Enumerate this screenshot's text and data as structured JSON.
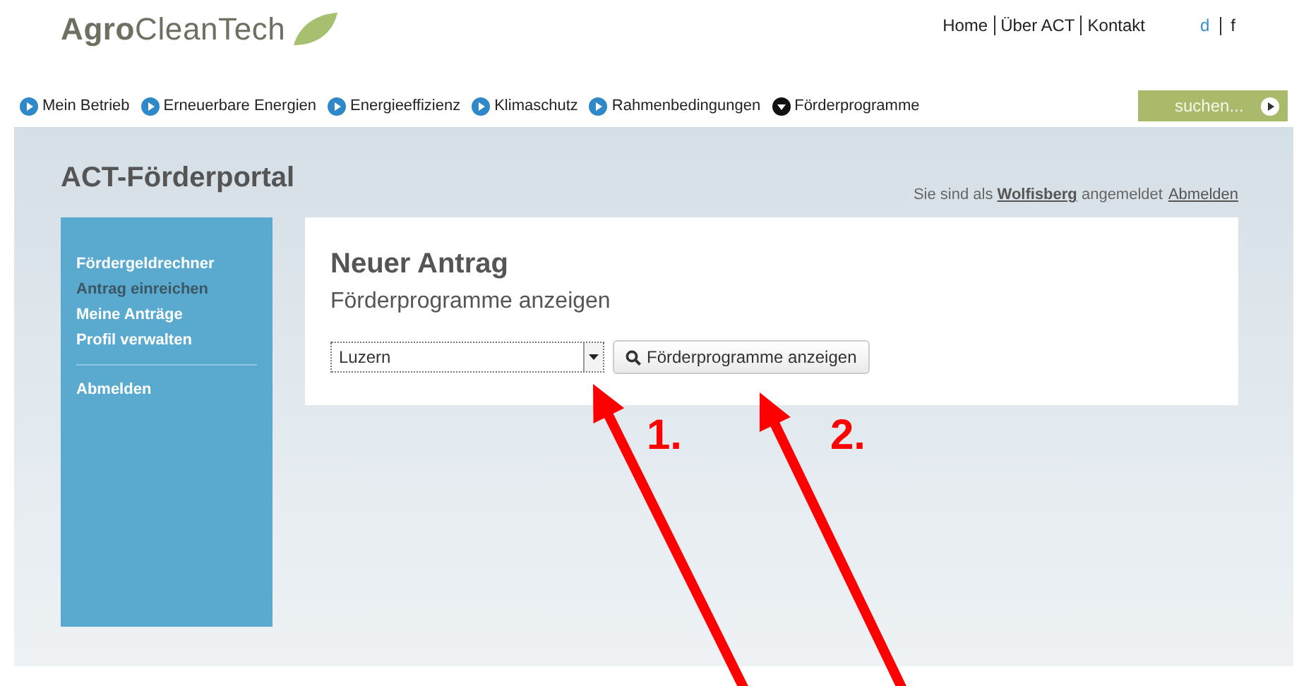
{
  "logo": {
    "text": "**Agro**CleanTech"
  },
  "top_links": [
    "Home",
    "Über ACT",
    "Kontakt"
  ],
  "languages": [
    {
      "label": "d",
      "selected": true
    },
    {
      "label": "f",
      "selected": false
    }
  ],
  "nav": [
    {
      "label": "Mein Betrieb",
      "selected": false
    },
    {
      "label": "Erneuerbare Energien",
      "selected": false
    },
    {
      "label": "Energieeffizienz",
      "selected": false
    },
    {
      "label": "Klimaschutz",
      "selected": false
    },
    {
      "label": "Rahmenbedingungen",
      "selected": false
    },
    {
      "label": "Förderprogramme",
      "selected": true
    }
  ],
  "search": {
    "placeholder": "suchen..."
  },
  "portal_title": "ACT-Förderportal",
  "login_status": {
    "text": "Sie sind als **Wolfisberg** angemeldet",
    "logout": "Abmelden"
  },
  "sidebar": {
    "items": [
      {
        "label": "Fördergeldrechner",
        "selected": false
      },
      {
        "label": "Antrag einreichen",
        "selected": true
      },
      {
        "label": "Meine Anträge",
        "selected": false
      },
      {
        "label": "Profil verwalten",
        "selected": false
      }
    ],
    "footer_item": "Abmelden"
  },
  "panel": {
    "title": "Neuer Antrag",
    "subtitle": "Förderprogramme anzeigen",
    "select_value": "Luzern",
    "button": "Förderprogramme anzeigen"
  },
  "annotations": [
    {
      "label": "1."
    },
    {
      "label": "2."
    }
  ]
}
